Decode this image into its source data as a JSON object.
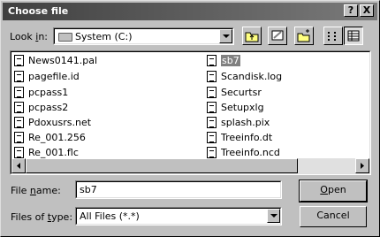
{
  "window": {
    "title": "Choose file",
    "help_label": "?",
    "close_label": "X"
  },
  "look_in": {
    "label_pre": "Look ",
    "label_key": "i",
    "label_post": "n:",
    "value": "System (C:)"
  },
  "toolbar": {
    "icons": [
      "up-folder-icon",
      "desktop-icon",
      "new-folder-icon",
      "list-view-icon",
      "details-view-icon"
    ]
  },
  "files": {
    "col1": [
      "News0141.pal",
      "pagefile.id",
      "pcpass1",
      "pcpass2",
      "Pdoxusrs.net",
      "Re_001.256",
      "Re_001.flc"
    ],
    "col2": [
      "sb7",
      "Scandisk.log",
      "Securtsr",
      "Setupxlg",
      "splash.pix",
      "Treeinfo.dt",
      "Treeinfo.ncd"
    ],
    "selected": "sb7"
  },
  "file_name": {
    "label_pre": "File ",
    "label_key": "n",
    "label_post": "ame:",
    "value": "sb7"
  },
  "file_type": {
    "label_pre": "Files of ",
    "label_key": "t",
    "label_post": "ype:",
    "value": "All Files (*.*)"
  },
  "buttons": {
    "open_key": "O",
    "open_rest": "pen",
    "cancel": "Cancel"
  }
}
